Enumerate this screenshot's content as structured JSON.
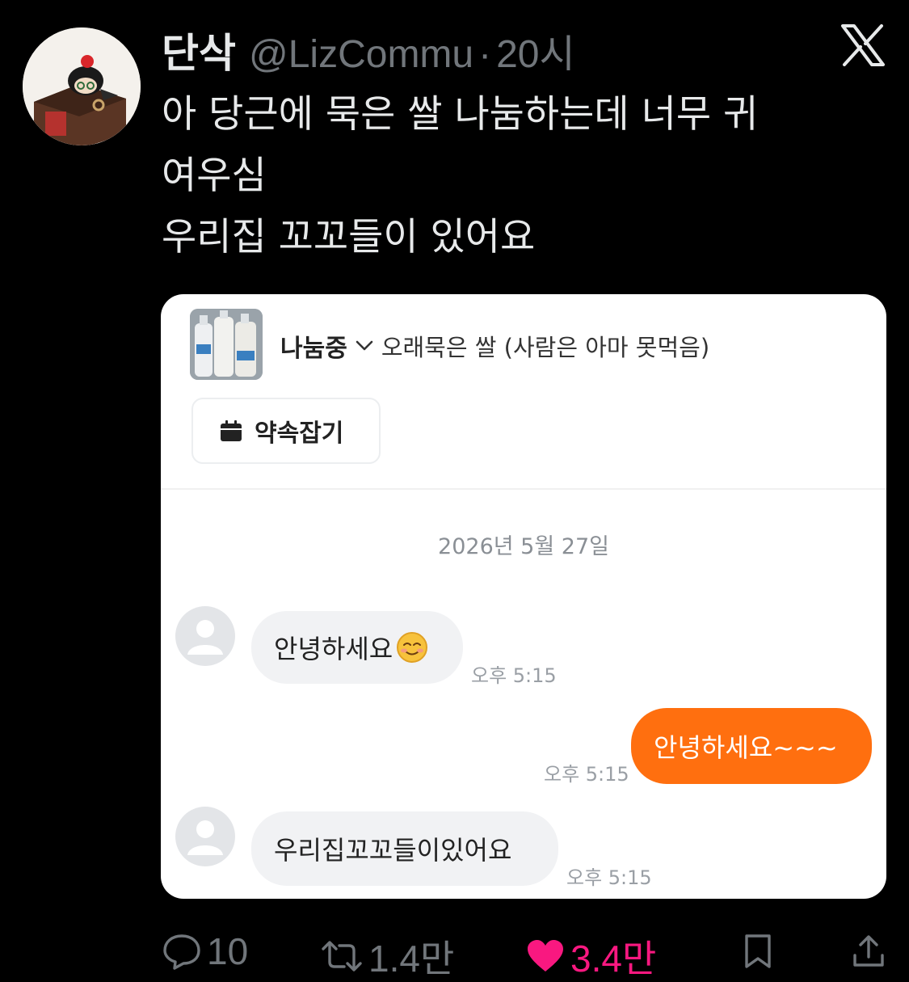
{
  "tweet": {
    "display_name": "단삭",
    "handle": "@LizCommu",
    "separator": "·",
    "time": "20시",
    "text_lines": [
      "아 당근에 묵은 쌀 나눔하는데 너무 귀",
      "여우심",
      "우리집 꼬꼬들이 있어요"
    ]
  },
  "card": {
    "listing_status": "나눔중",
    "listing_title": "오래묵은 쌀 (사람은 아마 못먹음)",
    "promise_button": "약속잡기",
    "date": "2026년 5월 27일",
    "messages": [
      {
        "direction": "in",
        "text": "안녕하세요",
        "emoji": "smiling-face-icon",
        "time": "오후 5:15"
      },
      {
        "direction": "out",
        "text": "안녕하세요~~~",
        "time": "오후 5:15"
      },
      {
        "direction": "in",
        "text": "우리집꼬꼬들이있어요",
        "time": "오후 5:15"
      }
    ]
  },
  "actions": {
    "replies": "10",
    "retweets": "1.4만",
    "likes": "3.4만",
    "like_state": "liked"
  },
  "colors": {
    "background": "#000000",
    "text": "#e7e9ea",
    "muted": "#71767b",
    "like": "#f91880",
    "carrot_orange": "#ff6f0f"
  }
}
